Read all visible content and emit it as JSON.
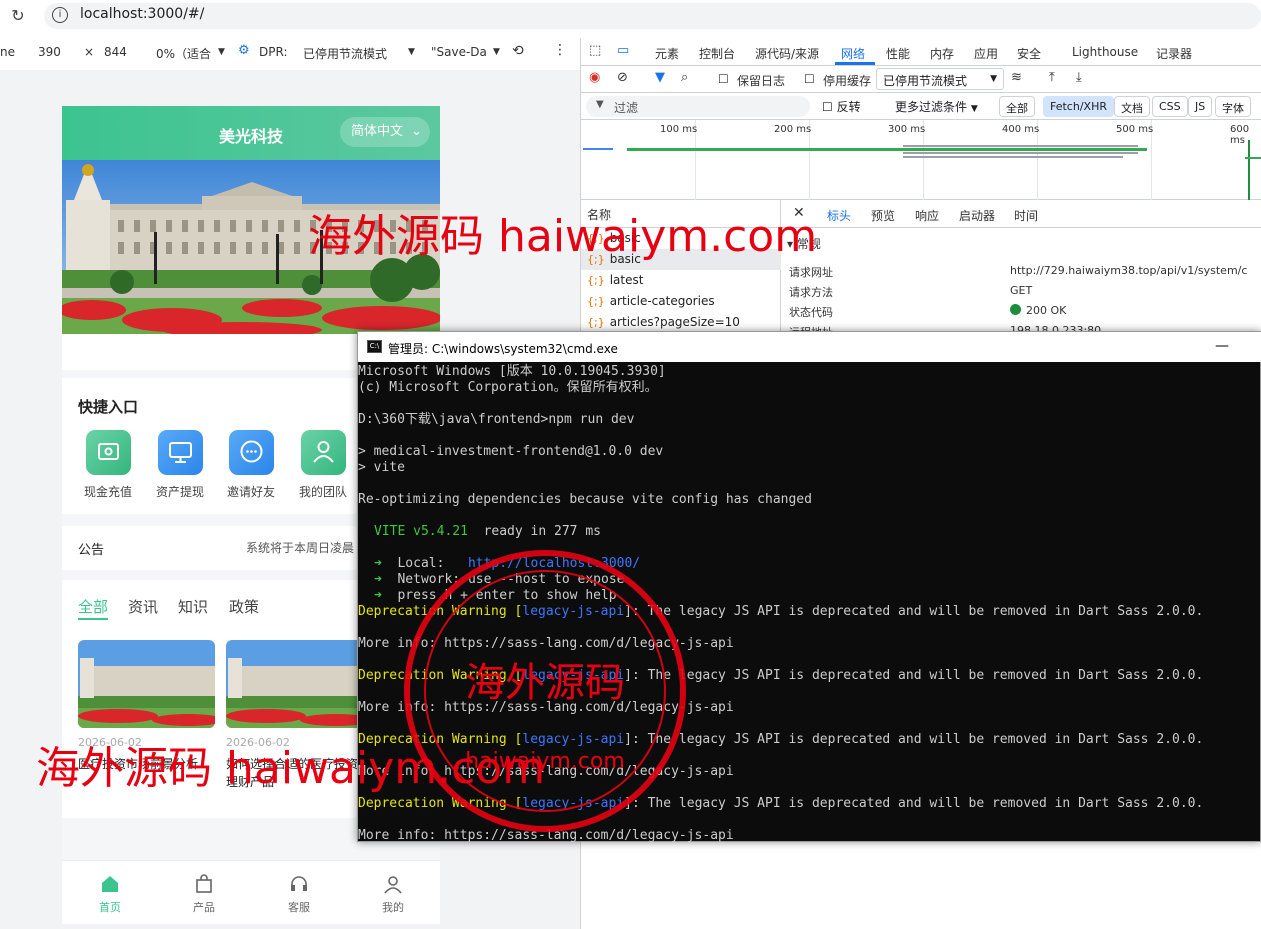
{
  "browser": {
    "url": "localhost:3000/#/"
  },
  "device_toolbar": {
    "device_partial": "ne",
    "width": "390",
    "times": "×",
    "height": "844",
    "zoom": "0%（适合",
    "dpr": "DPR:",
    "throttle": "已停用节流模式",
    "save_data": "\"Save-Dat"
  },
  "devtools": {
    "tabs": [
      "元素",
      "控制台",
      "源代码/来源",
      "网络",
      "性能",
      "内存",
      "应用",
      "安全",
      "Lighthouse",
      "记录器"
    ],
    "toolbar": {
      "preserve_log": "保留日志",
      "disable_cache": "停用缓存",
      "throttle": "已停用节流模式"
    },
    "filter": {
      "placeholder": "过滤",
      "invert": "反转",
      "more_filters": "更多过滤条件",
      "chips": [
        "全部",
        "Fetch/XHR",
        "文档",
        "CSS",
        "JS",
        "字体"
      ]
    },
    "timeline_ticks": [
      "100 ms",
      "200 ms",
      "300 ms",
      "400 ms",
      "500 ms",
      "600 ms"
    ],
    "list_header": "名称",
    "requests": [
      "basic",
      "basic",
      "latest",
      "article-categories",
      "articles?pageSize=10"
    ],
    "detail_tabs": [
      "标头",
      "预览",
      "响应",
      "启动器",
      "时间"
    ],
    "general_section": "常规",
    "headers": [
      {
        "key": "请求网址",
        "value": "http://729.haiwaiym38.top/api/v1/system/c"
      },
      {
        "key": "请求方法",
        "value": "GET"
      },
      {
        "key": "状态代码",
        "value": "200 OK"
      },
      {
        "key": "远程地址",
        "value": "198.18.0.233:80"
      }
    ]
  },
  "phone": {
    "app_title": "美光科技",
    "language": "简体中文",
    "quick_title": "快捷入口",
    "quick_items": [
      "现金充值",
      "资产提现",
      "邀请好友",
      "我的团队"
    ],
    "notice_title": "公告",
    "notice_text": "系统将于本周日凌晨",
    "news_tabs": [
      "全部",
      "资讯",
      "知识",
      "政策"
    ],
    "cards": [
      {
        "date": "2026-06-02",
        "title": "医疗投资市场前景分析"
      },
      {
        "date": "2026-06-02",
        "title": "如何选择合适的医疗投资理财产品"
      }
    ],
    "tabbar": [
      "首页",
      "产品",
      "客服",
      "我的"
    ],
    "accent": "#3cc48f"
  },
  "cmd": {
    "title": "管理员: C:\\windows\\system32\\cmd.exe",
    "minimize": "—",
    "lines": [
      "Microsoft Windows [版本 10.0.19045.3930]",
      "(c) Microsoft Corporation。保留所有权利。",
      "",
      "D:\\360下载\\java\\frontend>npm run dev",
      "",
      "> medical-investment-frontend@1.0.0 dev",
      "> vite",
      "",
      "Re-optimizing dependencies because vite config has changed",
      "",
      "VITE v5.4.21  ready in 277 ms",
      "",
      "Local:   http://localhost:3000/",
      "Network: use --host to expose",
      "press h + enter to show help",
      "Deprecation Warning [legacy-js-api]: The legacy JS API is deprecated and will be removed in Dart Sass 2.0.0.",
      "More info: https://sass-lang.com/d/legacy-js-api"
    ],
    "vite_label": "VITE v5.4.21",
    "ready": "ready in 277 ms",
    "local_label": "Local:",
    "local_url": "http://localhost:3000/",
    "network_label": "Network:",
    "network_text": "use --host to expose",
    "help_text": "press h + enter to show help",
    "warn_prefix": "Deprecation Warning [",
    "warn_tag": "legacy-js-api",
    "warn_suffix": "]: The legacy JS API is deprecated and will be removed in Dart Sass 2.0.0.",
    "more_info": "More info: https://sass-lang.com/d/legacy-js-api"
  },
  "watermarks": {
    "text1": "海外源码 haiwaiym.com",
    "text2": "海外源码 haiwaiym.com",
    "stamp_center": "海外源码",
    "stamp_url": "haiwaiym.com"
  }
}
